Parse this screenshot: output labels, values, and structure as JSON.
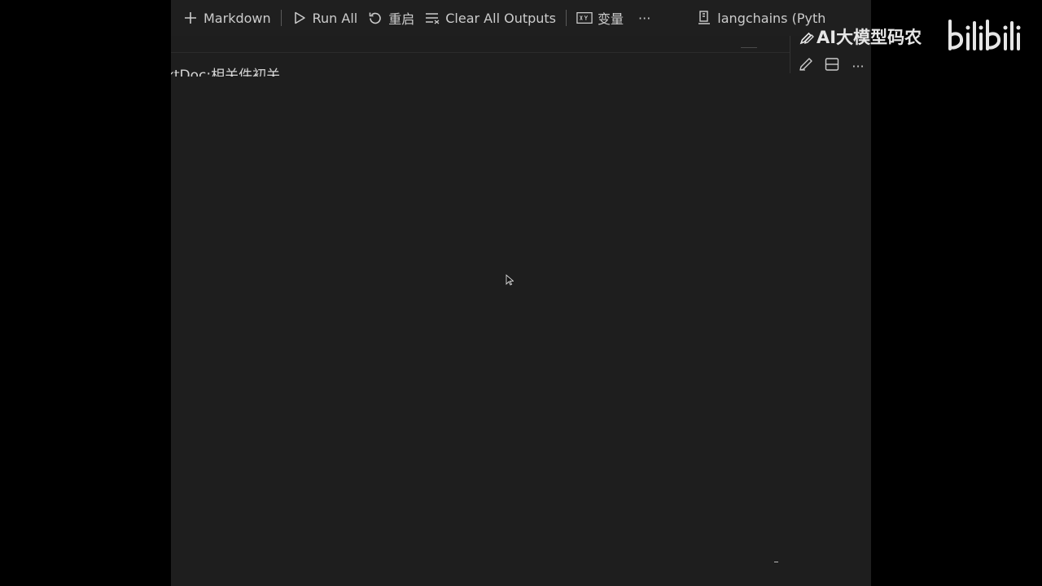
{
  "toolbar": {
    "add_markdown_label": "Markdown",
    "run_all_label": "Run All",
    "restart_label": "重启",
    "clear_outputs_label": "Clear All Outputs",
    "variables_label": "变量",
    "more_label": "···",
    "kernel_label": "langchains (Pyth"
  },
  "cell": {
    "partial_text": "ktDoc:相关件初关"
  },
  "cell_toolbar": {
    "more_label": "···"
  },
  "watermark": {
    "channel_name": "AI大模型码农",
    "site_logo_text": "bilibili"
  },
  "colors": {
    "frame_background": "#000000",
    "editor_background": "#1e1e1e",
    "toolbar_text": "#cccccc",
    "watermark_text": "#e6e6e6"
  },
  "icons": {
    "add": "plus-icon",
    "run": "play-icon",
    "restart": "restart-icon",
    "clear": "clear-outputs-icon",
    "variables": "variables-icon",
    "kernel": "kernel-icon",
    "edit": "pencil-icon",
    "split": "split-cell-icon"
  }
}
